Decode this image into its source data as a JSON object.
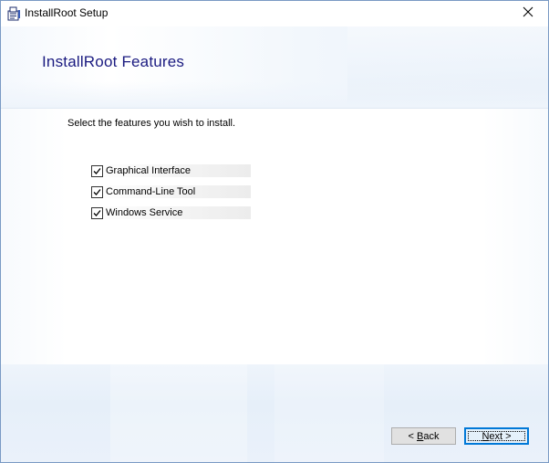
{
  "window": {
    "title": "InstallRoot Setup",
    "app_icon": "installer-icon",
    "close_icon": "close-icon"
  },
  "header": {
    "title": "InstallRoot Features"
  },
  "body": {
    "instruction": "Select the features you wish to install.",
    "features": [
      {
        "label": "Graphical Interface",
        "checked": true
      },
      {
        "label": "Command-Line Tool",
        "checked": true
      },
      {
        "label": "Windows Service",
        "checked": true
      }
    ]
  },
  "footer": {
    "back_prefix": "< ",
    "back_mnemonic": "B",
    "back_rest": "ack",
    "next_mnemonic": "N",
    "next_rest": "ext >"
  },
  "colors": {
    "title_blue": "#1a1a80",
    "focus_blue": "#0078d7",
    "button_gray": "#e1e1e1"
  }
}
